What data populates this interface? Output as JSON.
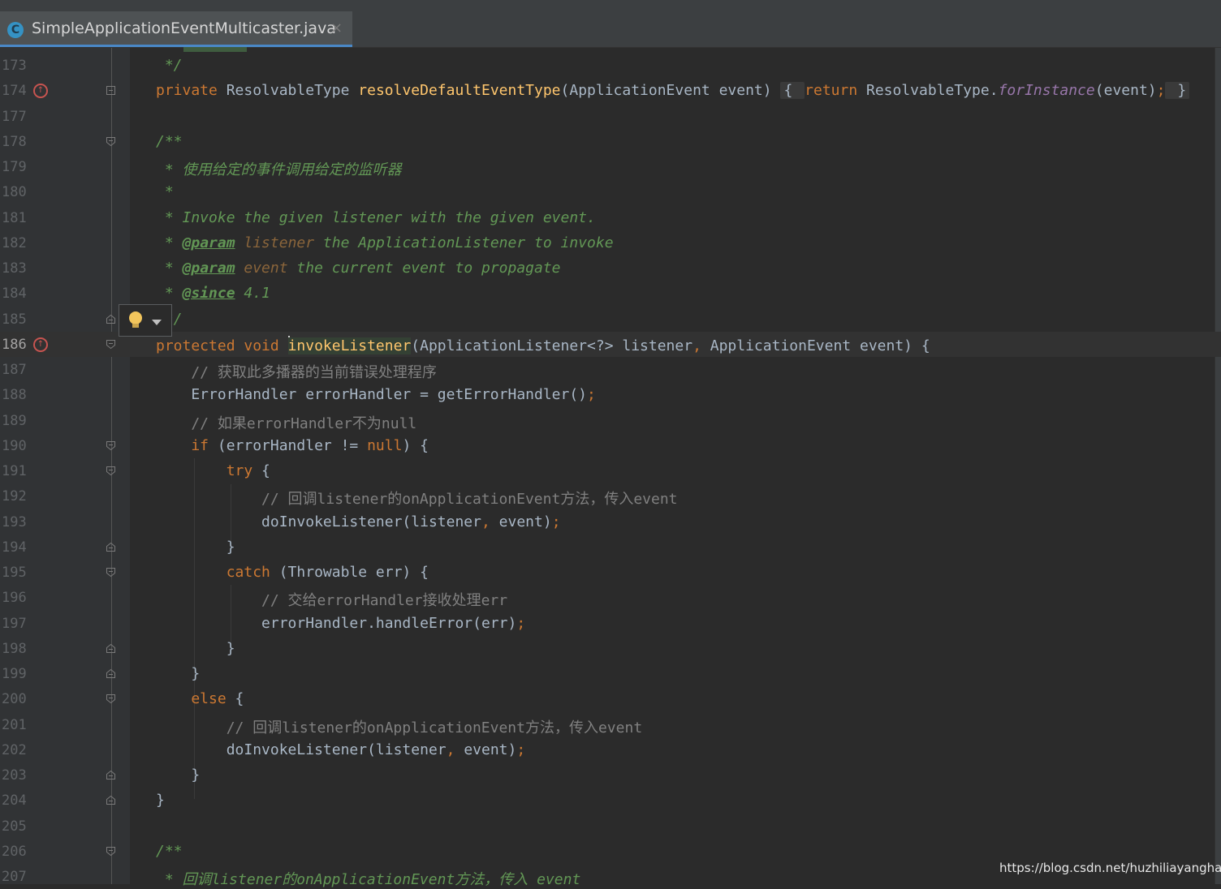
{
  "tab": {
    "label": "SimpleApplicationEventMulticaster.java",
    "icon": "C",
    "close": "×"
  },
  "lines": [
    {
      "num": "173",
      "frag": [
        [
          "doc",
          " */"
        ]
      ]
    },
    {
      "num": "174",
      "frag": [
        [
          "kw",
          "private "
        ],
        [
          "p",
          "ResolvableType "
        ],
        [
          "fn",
          "resolveDefaultEventType"
        ],
        [
          "p",
          "(ApplicationEvent event) "
        ],
        [
          "fold",
          "{ "
        ],
        [
          "kw",
          "return "
        ],
        [
          "p",
          "ResolvableType."
        ],
        [
          "st",
          "forInstance"
        ],
        [
          "p",
          "(event)"
        ],
        [
          "kw",
          ";"
        ],
        [
          "fold",
          " }"
        ]
      ]
    },
    {
      "num": "177",
      "frag": []
    },
    {
      "num": "178",
      "frag": [
        [
          "doc",
          "/**"
        ]
      ]
    },
    {
      "num": "179",
      "frag": [
        [
          "doc",
          " * 使用给定的事件调用给定的监听器"
        ]
      ]
    },
    {
      "num": "180",
      "frag": [
        [
          "doc",
          " *"
        ]
      ]
    },
    {
      "num": "181",
      "frag": [
        [
          "doc",
          " * Invoke the given listener with the given event."
        ]
      ]
    },
    {
      "num": "182",
      "frag": [
        [
          "doc",
          " * "
        ],
        [
          "tag",
          "@param"
        ],
        [
          "pn",
          " listener"
        ],
        [
          "doc",
          " the ApplicationListener to invoke"
        ]
      ]
    },
    {
      "num": "183",
      "frag": [
        [
          "doc",
          " * "
        ],
        [
          "tag",
          "@param"
        ],
        [
          "pn",
          " event"
        ],
        [
          "doc",
          " the current event to propagate"
        ]
      ]
    },
    {
      "num": "184",
      "frag": [
        [
          "doc",
          " * "
        ],
        [
          "tag",
          "@since"
        ],
        [
          "doc",
          " 4.1"
        ]
      ]
    },
    {
      "num": "185",
      "frag": [
        [
          "doc",
          " */"
        ]
      ]
    },
    {
      "num": "186",
      "frag": [
        [
          "kw",
          "protected void "
        ],
        [
          "caret",
          ""
        ],
        [
          "fn",
          "invokeListener"
        ],
        [
          "p",
          "(ApplicationListener<?> listener"
        ],
        [
          "kw",
          ", "
        ],
        [
          "p",
          "ApplicationEvent event) {"
        ]
      ]
    },
    {
      "num": "187",
      "frag": [
        [
          "cm",
          "    // 获取此多播器的当前错误处理程序"
        ]
      ]
    },
    {
      "num": "188",
      "frag": [
        [
          "p",
          "    ErrorHandler errorHandler = getErrorHandler()"
        ],
        [
          "kw",
          ";"
        ]
      ]
    },
    {
      "num": "189",
      "frag": [
        [
          "cm",
          "    // 如果errorHandler不为null"
        ]
      ]
    },
    {
      "num": "190",
      "frag": [
        [
          "kw",
          "    if "
        ],
        [
          "p",
          "(errorHandler != "
        ],
        [
          "kw",
          "null"
        ],
        [
          "p",
          ") {"
        ]
      ]
    },
    {
      "num": "191",
      "frag": [
        [
          "kw",
          "        try "
        ],
        [
          "p",
          "{"
        ]
      ]
    },
    {
      "num": "192",
      "frag": [
        [
          "cm",
          "            // 回调listener的onApplicationEvent方法，传入event"
        ]
      ]
    },
    {
      "num": "193",
      "frag": [
        [
          "p",
          "            doInvokeListener(listener"
        ],
        [
          "kw",
          ", "
        ],
        [
          "p",
          "event)"
        ],
        [
          "kw",
          ";"
        ]
      ]
    },
    {
      "num": "194",
      "frag": [
        [
          "p",
          "        }"
        ]
      ]
    },
    {
      "num": "195",
      "frag": [
        [
          "kw",
          "        catch "
        ],
        [
          "p",
          "(Throwable err) {"
        ]
      ]
    },
    {
      "num": "196",
      "frag": [
        [
          "cm",
          "            // 交给errorHandler接收处理err"
        ]
      ]
    },
    {
      "num": "197",
      "frag": [
        [
          "p",
          "            errorHandler.handleError(err)"
        ],
        [
          "kw",
          ";"
        ]
      ]
    },
    {
      "num": "198",
      "frag": [
        [
          "p",
          "        }"
        ]
      ]
    },
    {
      "num": "199",
      "frag": [
        [
          "p",
          "    }"
        ]
      ]
    },
    {
      "num": "200",
      "frag": [
        [
          "kw",
          "    else "
        ],
        [
          "p",
          "{"
        ]
      ]
    },
    {
      "num": "201",
      "frag": [
        [
          "cm",
          "        // 回调listener的onApplicationEvent方法，传入event"
        ]
      ]
    },
    {
      "num": "202",
      "frag": [
        [
          "p",
          "        doInvokeListener(listener"
        ],
        [
          "kw",
          ", "
        ],
        [
          "p",
          "event)"
        ],
        [
          "kw",
          ";"
        ]
      ]
    },
    {
      "num": "203",
      "frag": [
        [
          "p",
          "    }"
        ]
      ]
    },
    {
      "num": "204",
      "frag": [
        [
          "p",
          "}"
        ]
      ]
    },
    {
      "num": "205",
      "frag": []
    },
    {
      "num": "206",
      "frag": [
        [
          "doc",
          "/**"
        ]
      ]
    },
    {
      "num": "207",
      "frag": [
        [
          "doc",
          " * 回调listener的onApplicationEvent方法，传入 event"
        ]
      ]
    }
  ],
  "watermark": "https://blog.csdn.net/huzhiliayanghao"
}
